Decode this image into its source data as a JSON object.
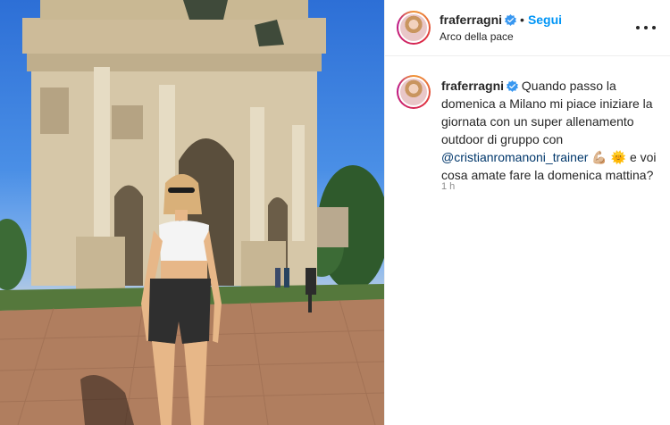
{
  "post": {
    "username": "fraferragni",
    "follow_label": "Segui",
    "location": "Arco della pace",
    "caption": {
      "username": "fraferragni",
      "text_1": "Quando passo la domenica a Milano mi piace iniziare la giornata con un super allenamento outdoor di gruppo con",
      "mention": "@cristianromanoni_trainer",
      "emojis": "💪🏼 🌞",
      "text_2": "e voi cosa amate fare la domenica mattina?"
    },
    "timestamp": "1 h"
  },
  "icons": {
    "verified": "verified-badge-icon",
    "more": "more-options-icon"
  },
  "colors": {
    "link": "#0095f6",
    "mention": "#00376b",
    "verified": "#3897f0",
    "muted": "#8e8e8e"
  }
}
